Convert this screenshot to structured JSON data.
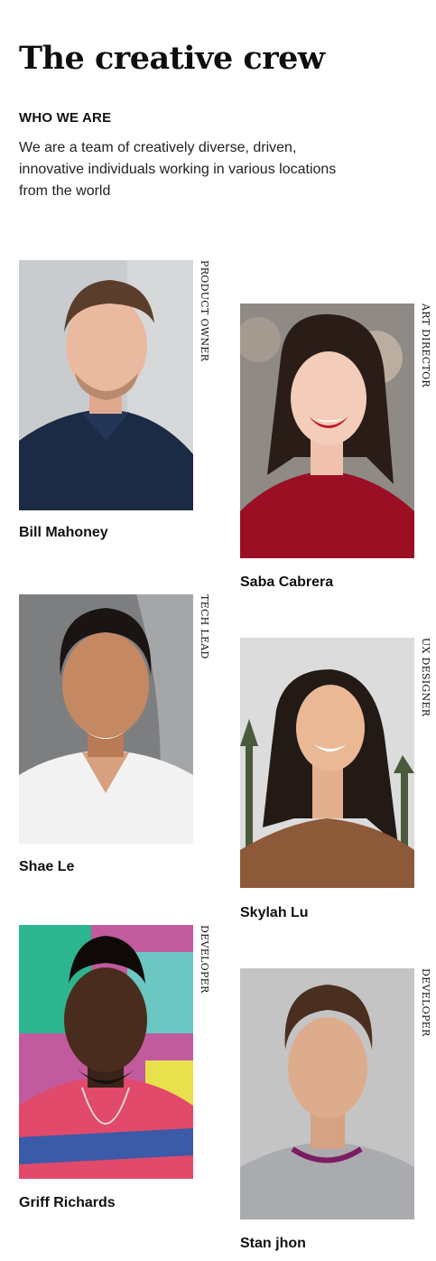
{
  "header": {
    "title": "The creative crew",
    "eyebrow": "WHO WE ARE",
    "intro": "We are a team of creatively diverse, driven, innovative individuals working in various locations from the world"
  },
  "team": [
    {
      "name": "Bill Mahoney",
      "role": "PRODUCT OWNER"
    },
    {
      "name": "Saba Cabrera",
      "role": "ART DIRECTOR"
    },
    {
      "name": "Shae Le",
      "role": "TECH LEAD"
    },
    {
      "name": "Skylah Lu",
      "role": "UX DESIGNER"
    },
    {
      "name": "Griff Richards",
      "role": "DEVELOPER"
    },
    {
      "name": "Stan jhon",
      "role": "DEVELOPER"
    }
  ]
}
